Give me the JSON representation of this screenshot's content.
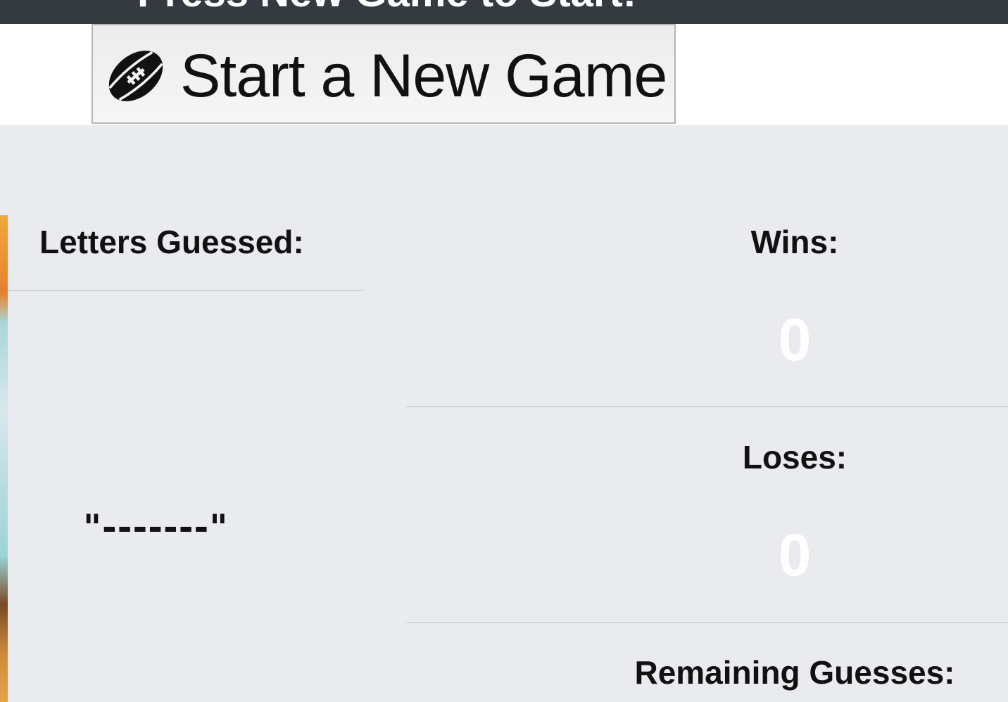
{
  "header": {
    "banner_text": "Press New Game to Start!"
  },
  "toolbar": {
    "new_game_label": "Start a New Game",
    "new_game_icon": "football-icon"
  },
  "guesses": {
    "heading": "Letters Guessed:",
    "word_display": "\"-------\""
  },
  "stats": {
    "wins_label": "Wins:",
    "wins_value": "0",
    "loses_label": "Loses:",
    "loses_value": "0",
    "remaining_label": "Remaining Guesses:"
  }
}
